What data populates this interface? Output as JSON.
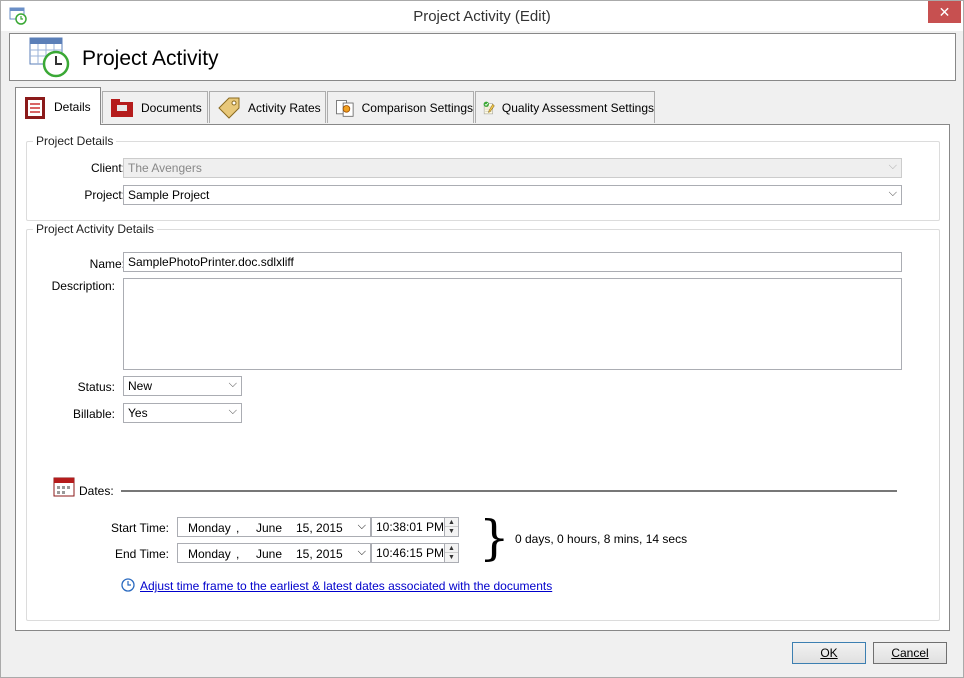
{
  "window": {
    "title": "Project Activity (Edit)"
  },
  "header": {
    "title": "Project Activity"
  },
  "tabs": [
    {
      "label": "Details",
      "icon": "clipboard-checklist-icon",
      "active": true
    },
    {
      "label": "Documents",
      "icon": "red-folder-icon",
      "active": false
    },
    {
      "label": "Activity Rates",
      "icon": "price-tag-icon",
      "active": false
    },
    {
      "label": "Comparison Settings",
      "icon": "compare-icon",
      "active": false
    },
    {
      "label": "Quality Assessment Settings",
      "icon": "notepad-check-icon",
      "active": false
    }
  ],
  "project_details": {
    "legend": "Project Details",
    "client_label": "Client:",
    "client_value": "The Avengers",
    "project_label": "Project:",
    "project_value": "Sample Project"
  },
  "activity_details": {
    "legend": "Project Activity Details",
    "name_label": "Name:",
    "name_value": "SamplePhotoPrinter.doc.sdlxliff",
    "description_label": "Description:",
    "description_value": "",
    "status_label": "Status:",
    "status_value": "New",
    "billable_label": "Billable:",
    "billable_value": "Yes"
  },
  "dates": {
    "label": "Dates:",
    "start_label": "Start Time:",
    "start_day": "Monday",
    "start_month": "June",
    "start_date": "15, 2015",
    "start_time": "10:38:01 PM",
    "end_label": "End Time:",
    "end_day": "Monday",
    "end_month": "June",
    "end_date": "15, 2015",
    "end_time": "10:46:15 PM",
    "separator": ",",
    "duration": "0 days, 0 hours, 8 mins, 14 secs",
    "adjust_link": "Adjust time frame to the earliest & latest dates associated with the documents"
  },
  "buttons": {
    "ok": "OK",
    "cancel": "Cancel"
  },
  "colors": {
    "close": "#c75050",
    "link": "#0000cc",
    "accent_green": "#3aa835"
  }
}
